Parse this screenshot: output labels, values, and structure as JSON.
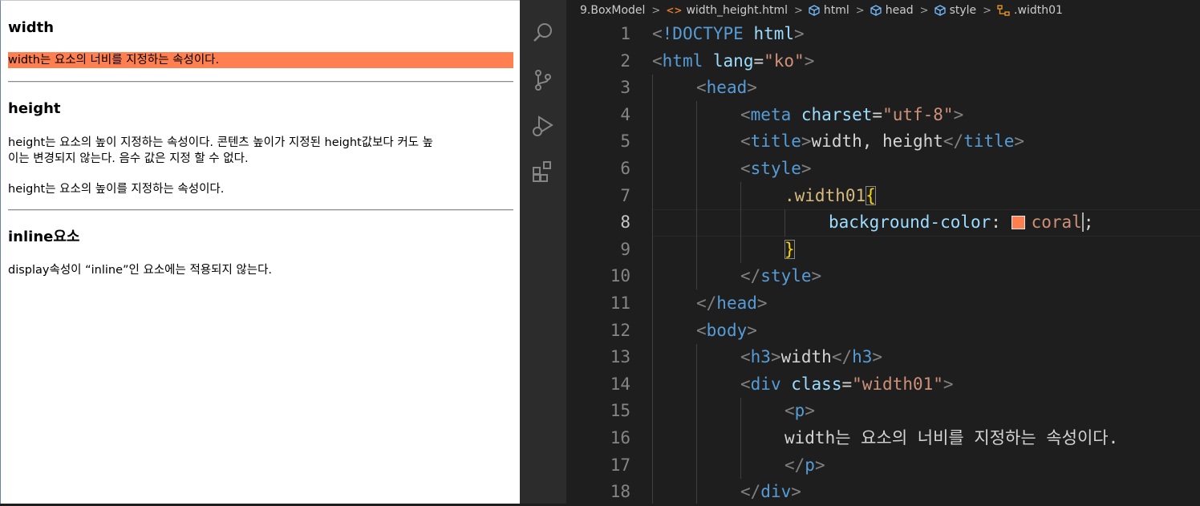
{
  "preview": {
    "sections": [
      {
        "heading": "width",
        "text": "width는 요소의 너비를 지정하는 속성이다."
      },
      {
        "heading": "height",
        "text1": "height는 요소의 높이 지정하는 속성이다. 콘텐츠 높이가 지정된 height값보다 커도 높",
        "text1b": "이는 변경되지 않는다. 음수 값은 지정 할 수 없다.",
        "text2": "height는 요소의 높이를 지정하는 속성이다."
      },
      {
        "heading": "inline요소",
        "text": "display속성이 “inline”인 요소에는 적용되지 않는다."
      }
    ],
    "coral_color": "#ff7f50"
  },
  "vscode": {
    "activity_icons": [
      "search-icon",
      "source-control-icon",
      "run-debug-icon",
      "extensions-icon"
    ],
    "breadcrumb": {
      "folder": "9.BoxModel",
      "file": "width_height.html",
      "html": "html",
      "head": "head",
      "style": "style",
      "selector": ".width01"
    },
    "active_line": "8",
    "line_numbers": [
      "1",
      "2",
      "3",
      "4",
      "5",
      "6",
      "7",
      "8",
      "9",
      "10",
      "11",
      "12",
      "13",
      "14",
      "15",
      "16",
      "17",
      "18"
    ],
    "code": {
      "l1_doctype": "!DOCTYPE",
      "l1_html": "html",
      "l2_tag": "html",
      "l2_attr": "lang",
      "l2_val": "\"ko\"",
      "l3_tag": "head",
      "l4_tag": "meta",
      "l4_attr": "charset",
      "l4_val": "\"utf-8\"",
      "l5_tag": "title",
      "l5_text": "width, height",
      "l6_tag": "style",
      "l7_selector": ".width01",
      "l8_prop": "background-color",
      "l8_value": "coral",
      "l10_tag": "style",
      "l11_tag": "head",
      "l12_tag": "body",
      "l13_tag": "h3",
      "l13_text": "width",
      "l14_tag": "div",
      "l14_attr": "class",
      "l14_val": "\"width01\"",
      "l15_tag": "p",
      "l16_text": "width는 요소의 너비를 지정하는 속성이다.",
      "l17_tag": "p",
      "l18_tag": "div"
    }
  }
}
